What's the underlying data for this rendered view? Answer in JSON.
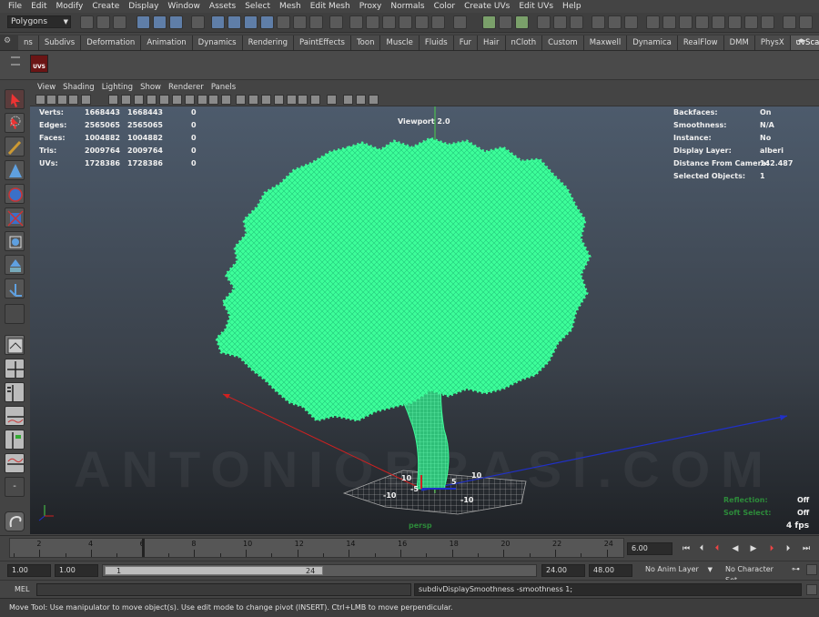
{
  "menu": [
    "File",
    "Edit",
    "Modify",
    "Create",
    "Display",
    "Window",
    "Assets",
    "Select",
    "Mesh",
    "Edit Mesh",
    "Proxy",
    "Normals",
    "Color",
    "Create UVs",
    "Edit UVs",
    "Help"
  ],
  "mode": "Polygons",
  "shelf_tabs": [
    "ns",
    "Subdivs",
    "Deformation",
    "Animation",
    "Dynamics",
    "Rendering",
    "PaintEffects",
    "Toon",
    "Muscle",
    "Fluids",
    "Fur",
    "Hair",
    "nCloth",
    "Custom",
    "Maxwell",
    "Dynamica",
    "RealFlow",
    "DMM",
    "PhysX",
    "uvScatter"
  ],
  "active_shelf": "uvScatter",
  "shelf_icon_label": "UVS",
  "panel_menu": [
    "View",
    "Shading",
    "Lighting",
    "Show",
    "Renderer",
    "Panels"
  ],
  "viewport": {
    "title": "Viewport 2.0",
    "camera": "persp",
    "fps": "4 fps",
    "stats": [
      {
        "label": "Verts:",
        "a": "1668443",
        "b": "1668443",
        "c": "0"
      },
      {
        "label": "Edges:",
        "a": "2565065",
        "b": "2565065",
        "c": "0"
      },
      {
        "label": "Faces:",
        "a": "1004882",
        "b": "1004882",
        "c": "0"
      },
      {
        "label": "Tris:",
        "a": "2009764",
        "b": "2009764",
        "c": "0"
      },
      {
        "label": "UVs:",
        "a": "1728386",
        "b": "1728386",
        "c": "0"
      }
    ],
    "info": [
      {
        "label": "Backfaces:",
        "value": "On"
      },
      {
        "label": "Smoothness:",
        "value": "N/A"
      },
      {
        "label": "Instance:",
        "value": "No"
      },
      {
        "label": "Display Layer:",
        "value": "alberi"
      },
      {
        "label": "Distance From Camera:",
        "value": "142.487"
      },
      {
        "label": "Selected Objects:",
        "value": "1"
      }
    ],
    "reflection": {
      "label": "Reflection:",
      "value": "Off"
    },
    "soft_select": {
      "label": "Soft Select:",
      "value": "Off"
    },
    "grid_labels": [
      "10",
      "-5",
      "5",
      "10",
      "-10",
      "-10"
    ],
    "watermark": "ANTONIOBRASI.COM"
  },
  "timeline": {
    "ticks": [
      "2",
      "4",
      "6",
      "8",
      "10",
      "12",
      "14",
      "16",
      "18",
      "20",
      "22",
      "24"
    ],
    "current": "6.00"
  },
  "range": {
    "start": "1.00",
    "playback_start": "1.00",
    "slider_start": "1",
    "slider_end": "24",
    "playback_end": "24.00",
    "end": "48.00",
    "anim_layer": "No Anim Layer",
    "char_set": "No Character Set"
  },
  "command": {
    "label": "MEL",
    "result": "subdivDisplaySmoothness -smoothness 1;"
  },
  "help_text": "Move Tool: Use manipulator to move object(s). Use edit mode to change pivot (INSERT).  Ctrl+LMB to move perpendicular.",
  "colors": {
    "foliage": "#3dff9a",
    "viewport_top": "#4d5b6c",
    "viewport_bottom": "#1f2226",
    "accent_tab": "#5a5a5a"
  }
}
